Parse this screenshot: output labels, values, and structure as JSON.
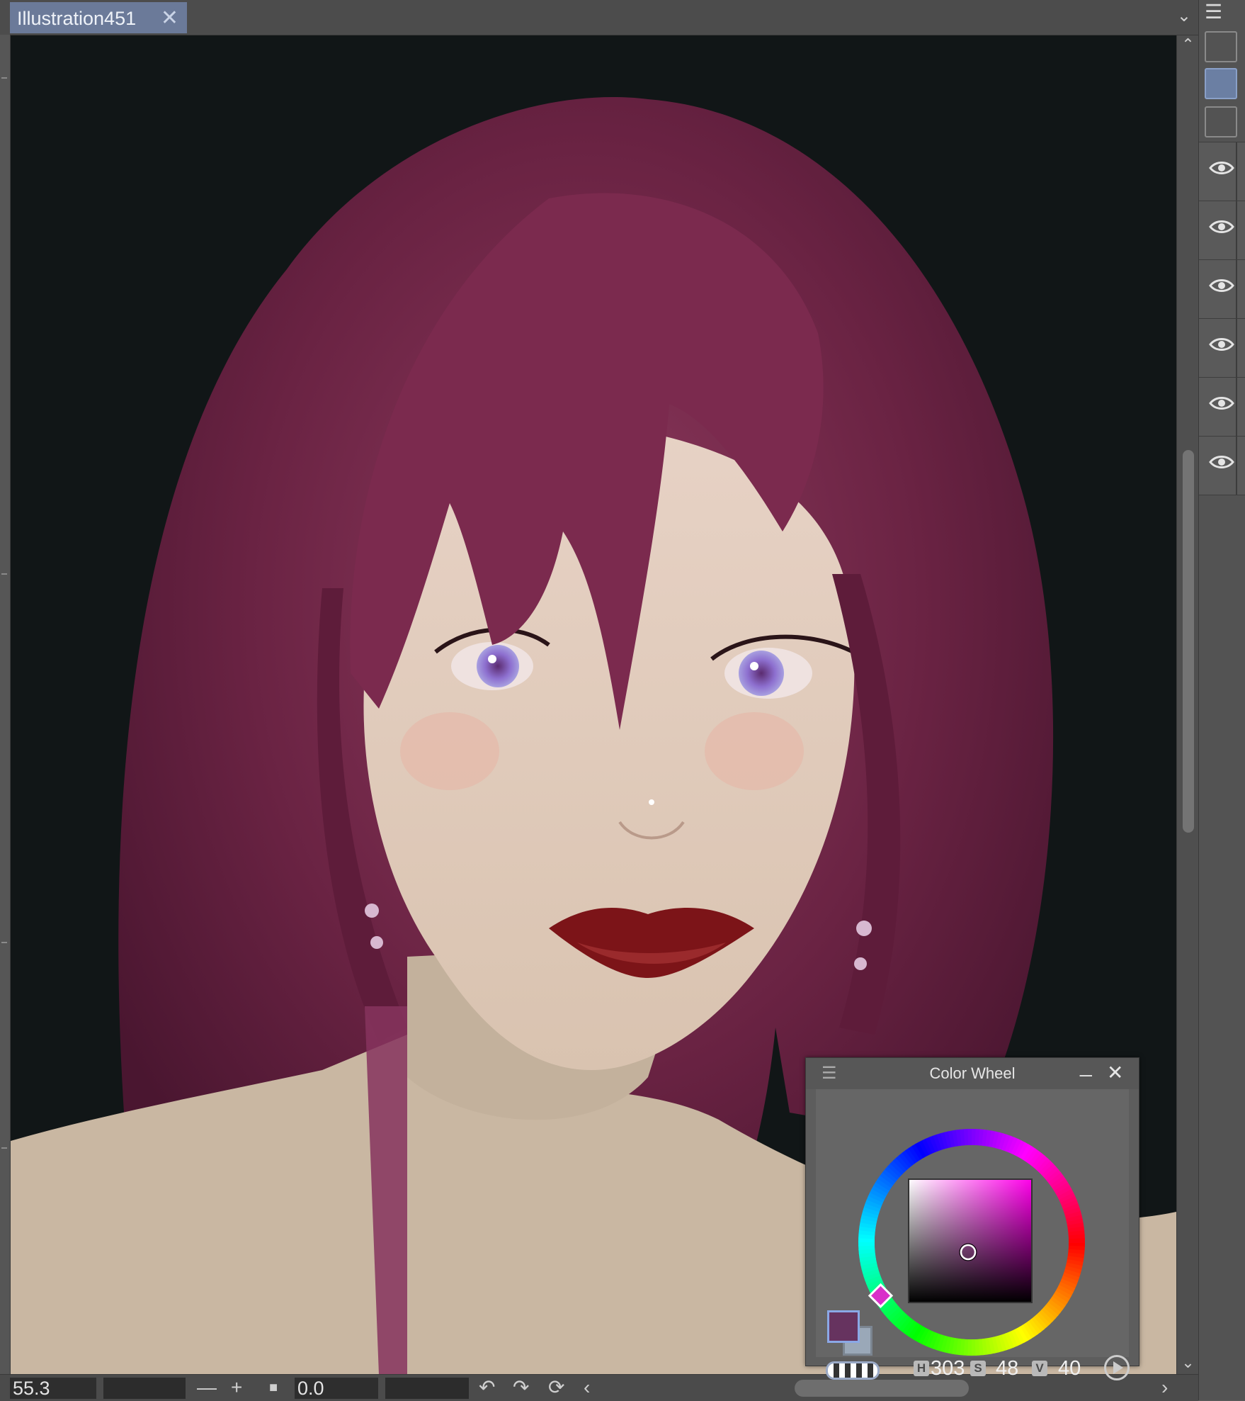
{
  "tab": {
    "title": "Illustration451",
    "close": "✕"
  },
  "tabbar": {
    "dropdown": "⌄"
  },
  "right_panel": {
    "menu": "☰",
    "layer_count": 6
  },
  "scrollbar": {
    "up": "⌃",
    "down": "⌄"
  },
  "status": {
    "zoom": "55.3",
    "minus": "—",
    "plus": "+",
    "square": "■",
    "rotation": "0.0",
    "undo": "↶",
    "redo": "↷",
    "reset": "⟳",
    "scroll_left": "‹",
    "scroll_right": "›"
  },
  "color_wheel": {
    "title": "Color Wheel",
    "menu": "☰",
    "minimize": "_",
    "close": "✕",
    "main_color": "#66335f",
    "sub_color": "#9aa8b8",
    "h_label": "H",
    "s_label": "S",
    "v_label": "V",
    "h_value": "303",
    "s_value": "48",
    "v_value": "40"
  }
}
